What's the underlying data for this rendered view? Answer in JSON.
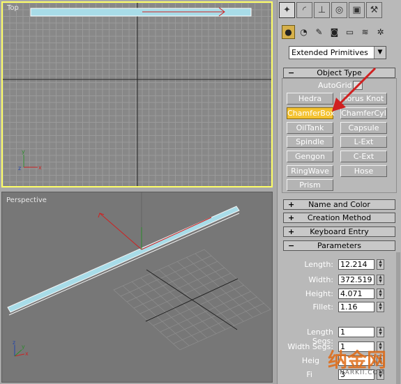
{
  "viewports": {
    "top_label": "Top",
    "perspective_label": "Perspective"
  },
  "command_panel": {
    "tabs": [
      "create-icon",
      "modify-icon",
      "hierarchy-icon",
      "motion-icon",
      "display-icon",
      "utilities-icon"
    ],
    "categories": [
      "geometry-icon",
      "shapes-icon",
      "lights-icon",
      "cameras-icon",
      "helpers-icon",
      "spacewarps-icon",
      "systems-icon"
    ],
    "dropdown_value": "Extended Primitives",
    "object_type": {
      "title": "Object Type",
      "sign": "−",
      "autogrid_label": "AutoGrid",
      "buttons": [
        "Hedra",
        "Torus Knot",
        "ChamferBox",
        "ChamferCyl",
        "OilTank",
        "Capsule",
        "Spindle",
        "L-Ext",
        "Gengon",
        "C-Ext",
        "RingWave",
        "Hose",
        "Prism"
      ],
      "active_button": "ChamferBox"
    },
    "rollouts": {
      "name_and_color": {
        "sign": "+",
        "title": "Name and Color"
      },
      "creation_method": {
        "sign": "+",
        "title": "Creation Method"
      },
      "keyboard_entry": {
        "sign": "+",
        "title": "Keyboard Entry"
      },
      "parameters": {
        "sign": "−",
        "title": "Parameters"
      }
    },
    "parameters": {
      "length": {
        "label": "Length:",
        "value": "12.214"
      },
      "width": {
        "label": "Width:",
        "value": "372.519"
      },
      "height": {
        "label": "Height:",
        "value": "4.071"
      },
      "fillet": {
        "label": "Fillet:",
        "value": "1.16"
      },
      "length_segs": {
        "label": "Length Segs:",
        "value": "1"
      },
      "width_segs": {
        "label": "Width Segs:",
        "value": "1"
      },
      "height_segs": {
        "label": "Heig",
        "value": ""
      },
      "fillet_segs": {
        "label": "Fi",
        "value": "3"
      }
    }
  },
  "watermark": {
    "text": "纳金网",
    "sub": "NARKII.COM"
  },
  "colors": {
    "viewport_active_border": "#ffff66",
    "selected_object": "#a8dce8",
    "annotation_arrow": "#d02020",
    "active_button": "#f4c230"
  }
}
